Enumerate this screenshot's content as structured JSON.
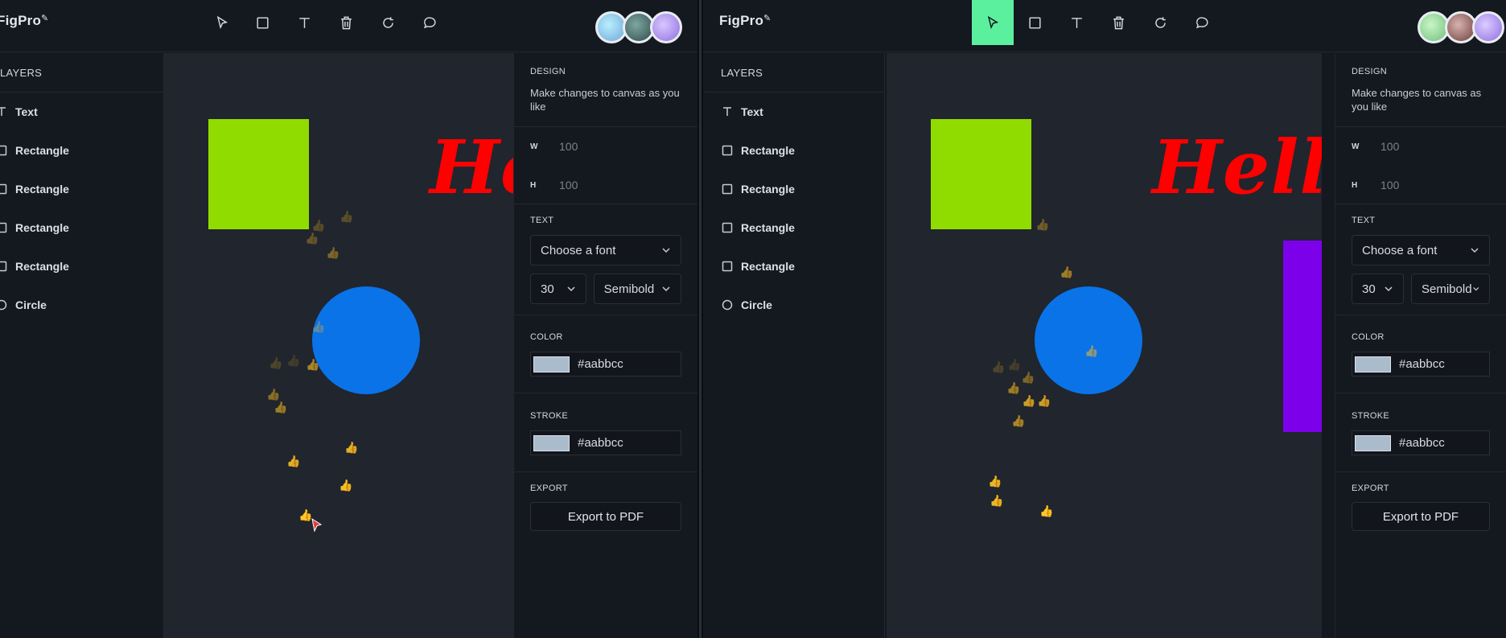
{
  "app": {
    "logo_main": "FigPro",
    "logo_accent": "o"
  },
  "toolbar": {
    "tools": [
      "select",
      "rectangle",
      "text",
      "delete",
      "reset",
      "comment"
    ]
  },
  "layers": {
    "title": "LAYERS",
    "items": [
      {
        "label": "Text",
        "icon": "text-icon"
      },
      {
        "label": "Rectangle",
        "icon": "square-icon"
      },
      {
        "label": "Rectangle",
        "icon": "square-icon"
      },
      {
        "label": "Rectangle",
        "icon": "square-icon"
      },
      {
        "label": "Rectangle",
        "icon": "square-icon"
      },
      {
        "label": "Circle",
        "icon": "circle-icon"
      }
    ]
  },
  "canvas": {
    "text_left": "He",
    "text_right": "Hello",
    "colors": {
      "green": "#91dc00",
      "blue": "#0a73e8",
      "red": "#ff0000",
      "purple": "#7d00eb",
      "background": "#20252e"
    },
    "reaction_emoji": "👍"
  },
  "design": {
    "title": "DESIGN",
    "description": "Make changes to canvas as you like",
    "w_label": "W",
    "w_value": "100",
    "h_label": "H",
    "h_value": "100",
    "text_title": "TEXT",
    "font_placeholder": "Choose a font",
    "font_size": "30",
    "font_weight": "Semibold",
    "color_title": "COLOR",
    "color_value": "#aabbcc",
    "stroke_title": "STROKE",
    "stroke_value": "#aabbcc",
    "export_title": "EXPORT",
    "export_button": "Export to PDF"
  },
  "colors": {
    "accent": "#5bf09e",
    "panel": "#14181f",
    "border": "#23272e"
  }
}
